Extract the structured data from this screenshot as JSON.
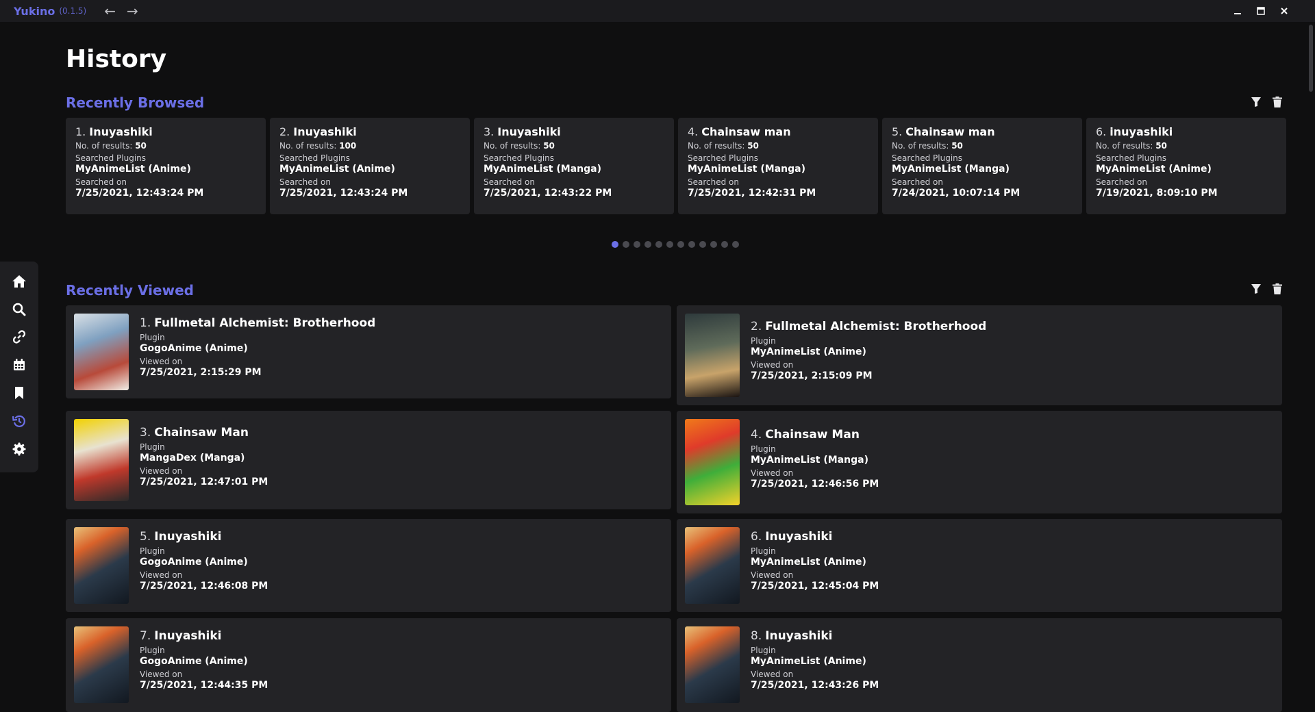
{
  "app": {
    "name": "Yukino",
    "version": "(0.1.5)"
  },
  "page": {
    "title": "History"
  },
  "recently_browsed": {
    "title": "Recently Browsed",
    "labels": {
      "results": "No. of results:",
      "plugins": "Searched Plugins",
      "searched_on": "Searched on"
    },
    "items": [
      {
        "index": "1.",
        "query": "Inuyashiki",
        "results": "50",
        "plugin": "MyAnimeList (Anime)",
        "date": "7/25/2021, 12:43:24 PM"
      },
      {
        "index": "2.",
        "query": "Inuyashiki",
        "results": "100",
        "plugin": "MyAnimeList (Anime)",
        "date": "7/25/2021, 12:43:24 PM"
      },
      {
        "index": "3.",
        "query": "Inuyashiki",
        "results": "50",
        "plugin": "MyAnimeList (Manga)",
        "date": "7/25/2021, 12:43:22 PM"
      },
      {
        "index": "4.",
        "query": "Chainsaw man",
        "results": "50",
        "plugin": "MyAnimeList (Manga)",
        "date": "7/25/2021, 12:42:31 PM"
      },
      {
        "index": "5.",
        "query": "Chainsaw man",
        "results": "50",
        "plugin": "MyAnimeList (Manga)",
        "date": "7/24/2021, 10:07:14 PM"
      },
      {
        "index": "6.",
        "query": "inuyashiki",
        "results": "50",
        "plugin": "MyAnimeList (Anime)",
        "date": "7/19/2021, 8:09:10 PM"
      }
    ],
    "pager": {
      "total": 12,
      "active": 1
    }
  },
  "recently_viewed": {
    "title": "Recently Viewed",
    "labels": {
      "plugin": "Plugin",
      "viewed_on": "Viewed on"
    },
    "items": [
      {
        "index": "1.",
        "title": "Fullmetal Alchemist: Brotherhood",
        "plugin": "GogoAnime (Anime)",
        "date": "7/25/2021, 2:15:29 PM",
        "thumb": "fma-cover-a"
      },
      {
        "index": "2.",
        "title": "Fullmetal Alchemist: Brotherhood",
        "plugin": "MyAnimeList (Anime)",
        "date": "7/25/2021, 2:15:09 PM",
        "thumb": "fma-cover-b"
      },
      {
        "index": "3.",
        "title": "Chainsaw Man",
        "plugin": "MangaDex (Manga)",
        "date": "7/25/2021, 12:47:01 PM",
        "thumb": "csm-cover-a"
      },
      {
        "index": "4.",
        "title": "Chainsaw Man",
        "plugin": "MyAnimeList (Manga)",
        "date": "7/25/2021, 12:46:56 PM",
        "thumb": "csm-cover-b"
      },
      {
        "index": "5.",
        "title": "Inuyashiki",
        "plugin": "GogoAnime (Anime)",
        "date": "7/25/2021, 12:46:08 PM",
        "thumb": "inuyashiki-cover"
      },
      {
        "index": "6.",
        "title": "Inuyashiki",
        "plugin": "MyAnimeList (Anime)",
        "date": "7/25/2021, 12:45:04 PM",
        "thumb": "inuyashiki-cover"
      },
      {
        "index": "7.",
        "title": "Inuyashiki",
        "plugin": "GogoAnime (Anime)",
        "date": "7/25/2021, 12:44:35 PM",
        "thumb": "inuyashiki-cover"
      },
      {
        "index": "8.",
        "title": "Inuyashiki",
        "plugin": "MyAnimeList (Anime)",
        "date": "7/25/2021, 12:43:26 PM",
        "thumb": "inuyashiki-cover"
      }
    ]
  },
  "sidebar": {
    "active": "history-icon",
    "items": [
      "home-icon",
      "search-icon",
      "link-icon",
      "calendar-icon",
      "bookmark-icon",
      "history-icon",
      "settings-icon"
    ]
  },
  "colors": {
    "accent": "#6b6fe6",
    "card": "#232326",
    "background": "#0f0f10"
  }
}
